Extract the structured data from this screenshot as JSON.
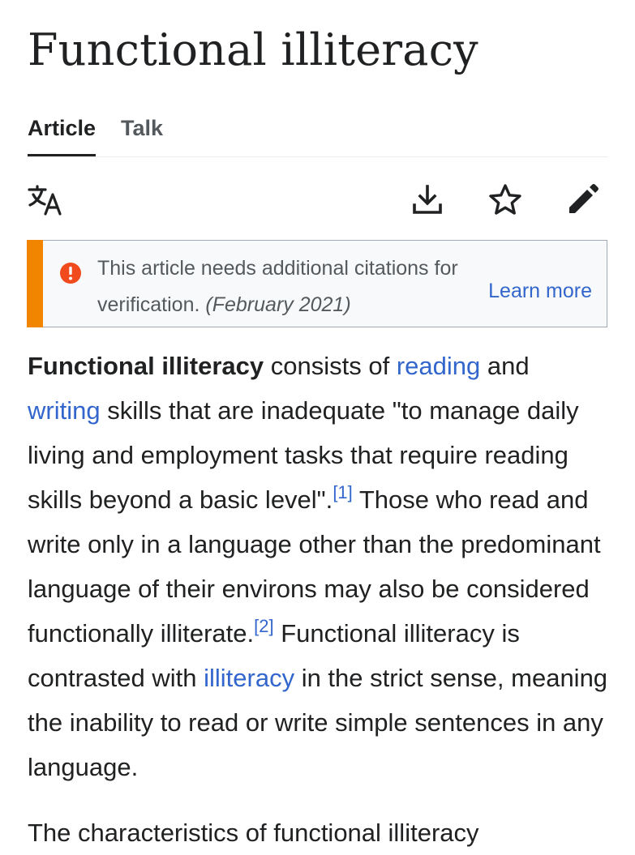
{
  "page_title": "Functional illiteracy",
  "tabs": [
    {
      "label": "Article",
      "active": true
    },
    {
      "label": "Talk",
      "active": false
    }
  ],
  "toolbar": {
    "language_icon": "translate-icon",
    "download_icon": "download-icon",
    "watch_icon": "star-icon",
    "edit_icon": "pencil-icon"
  },
  "notice": {
    "text": "This article needs additional citations for verification.",
    "date": "(February 2021)",
    "learn_more": "Learn more",
    "accent_color": "#f28500",
    "icon": "exclamation-circle-icon"
  },
  "paragraph1": {
    "lead_bold": "Functional illiteracy",
    "t1": " consists of ",
    "link_reading": "reading",
    "t2": " and ",
    "link_writing": "writing",
    "t3": " skills that are inadequate \"to manage daily living and employment tasks that require reading skills beyond a basic level\".",
    "ref1": "[1]",
    "t4": " Those who read and write only in a language other than the predominant language of their environs may also be considered functionally illiterate.",
    "ref2": "[2]",
    "t5": " Functional illiteracy is contrasted with ",
    "link_illiteracy": "illiteracy",
    "t6": " in the strict sense, meaning the inability to read or write simple sentences in any language."
  },
  "paragraph2_partial": "The characteristics of functional illiteracy",
  "link_color": "#3366cc"
}
